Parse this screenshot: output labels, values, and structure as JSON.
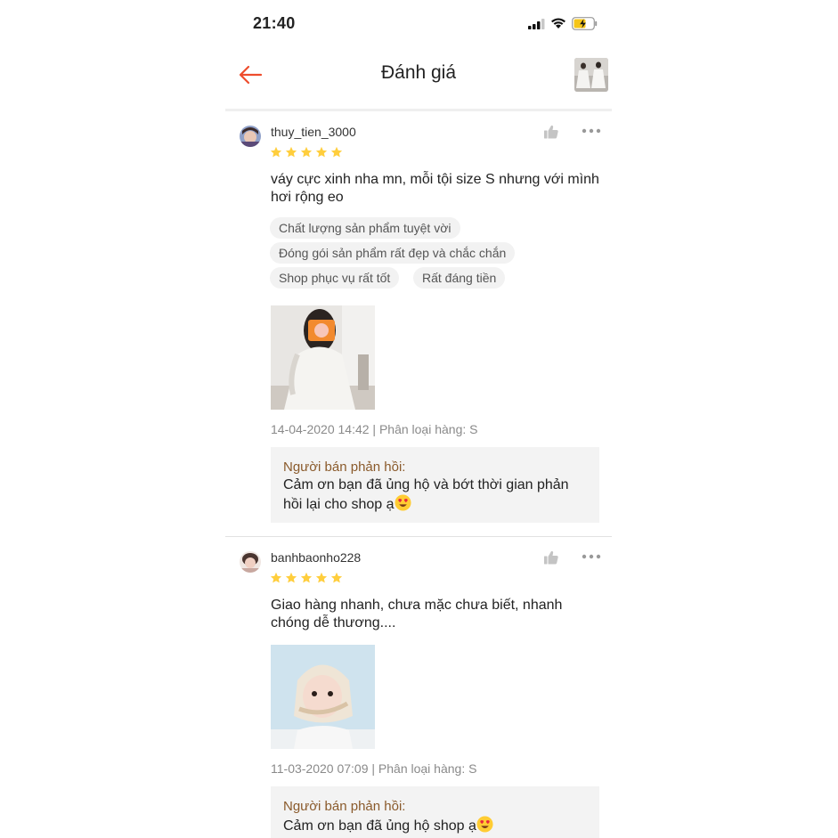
{
  "status_bar": {
    "time": "21:40"
  },
  "header": {
    "title": "Đánh giá"
  },
  "reviews": [
    {
      "username": "thuy_tien_3000",
      "rating": 5,
      "comment": "váy cực xinh nha mn, mỗi tội size S nhưng với mình hơi rộng eo",
      "tags": [
        "Chất lượng sản phẩm tuyệt vời",
        "Đóng gói sản phẩm rất đẹp và chắc chắn",
        "Shop phục vụ rất tốt",
        "Rất đáng tiền"
      ],
      "meta": "14-04-2020 14:42 | Phân loại hàng: S",
      "reply_label": "Người bán phản hồi:",
      "reply_text": "Cảm ơn bạn đã ủng hộ và bớt thời gian phản hồi lại cho shop ạ"
    },
    {
      "username": "banhbaonho228",
      "rating": 5,
      "comment": "Giao hàng nhanh, chưa mặc chưa biết, nhanh chóng dễ thương....",
      "meta": "11-03-2020 07:09 | Phân loại hàng: S",
      "reply_label": "Người bán phản hồi:",
      "reply_text": "Cảm ơn bạn đã ủng hộ shop ạ"
    }
  ],
  "colors": {
    "accent": "#ee4d2d",
    "star": "#ffce3d",
    "reply_label": "#8a5a2b"
  }
}
